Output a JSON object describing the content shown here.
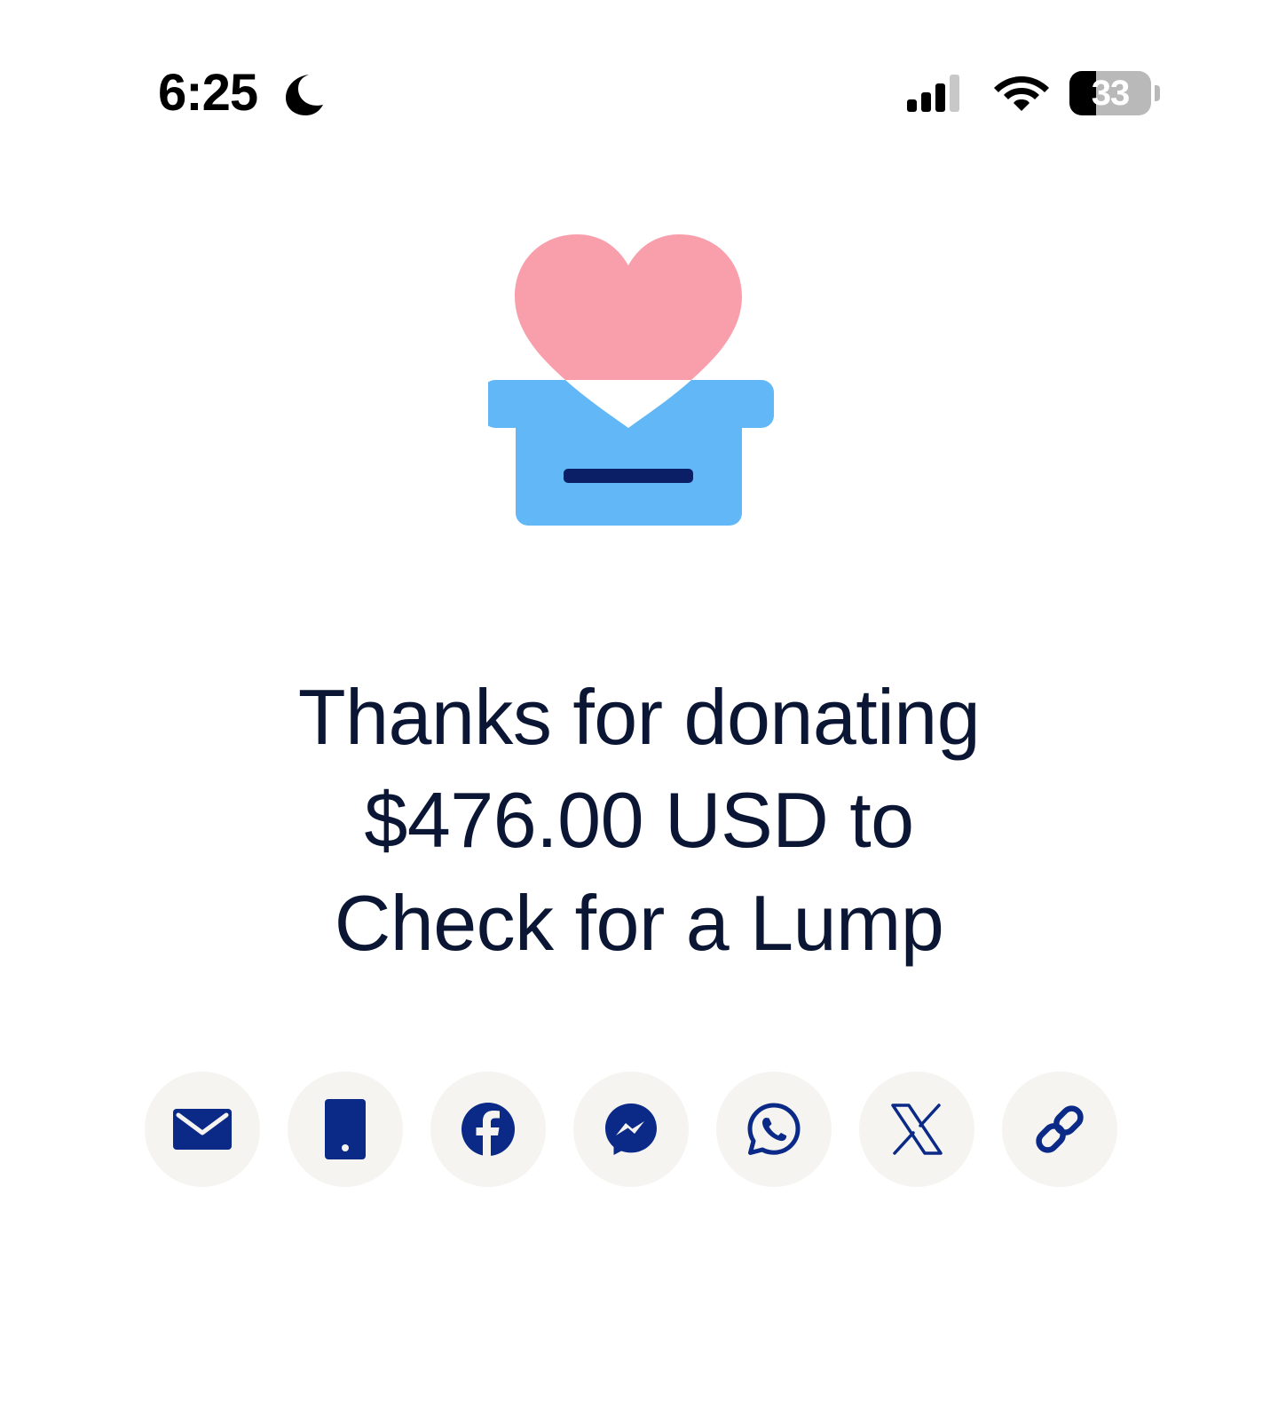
{
  "status_bar": {
    "time": "6:25",
    "focus_mode_icon": "moon-icon",
    "signal_icon": "cellular-signal-icon",
    "wifi_icon": "wifi-icon",
    "battery_level": "33",
    "battery_fraction": 0.33
  },
  "hero": {
    "icon": "donation-box-heart-icon",
    "colors": {
      "heart": "#f99fac",
      "box": "#62b8f7",
      "slot": "#0b1f66"
    }
  },
  "confirmation": {
    "line1": "Thanks for donating",
    "line2": "$476.00 USD to",
    "line3": "Check for a Lump"
  },
  "share": {
    "icon_color": "#0b2a88",
    "button_background": "#f5f4f1",
    "buttons": [
      {
        "icon": "email-icon"
      },
      {
        "icon": "sms-phone-icon"
      },
      {
        "icon": "facebook-icon"
      },
      {
        "icon": "messenger-icon"
      },
      {
        "icon": "whatsapp-icon"
      },
      {
        "icon": "x-twitter-icon"
      },
      {
        "icon": "copy-link-icon"
      }
    ]
  }
}
